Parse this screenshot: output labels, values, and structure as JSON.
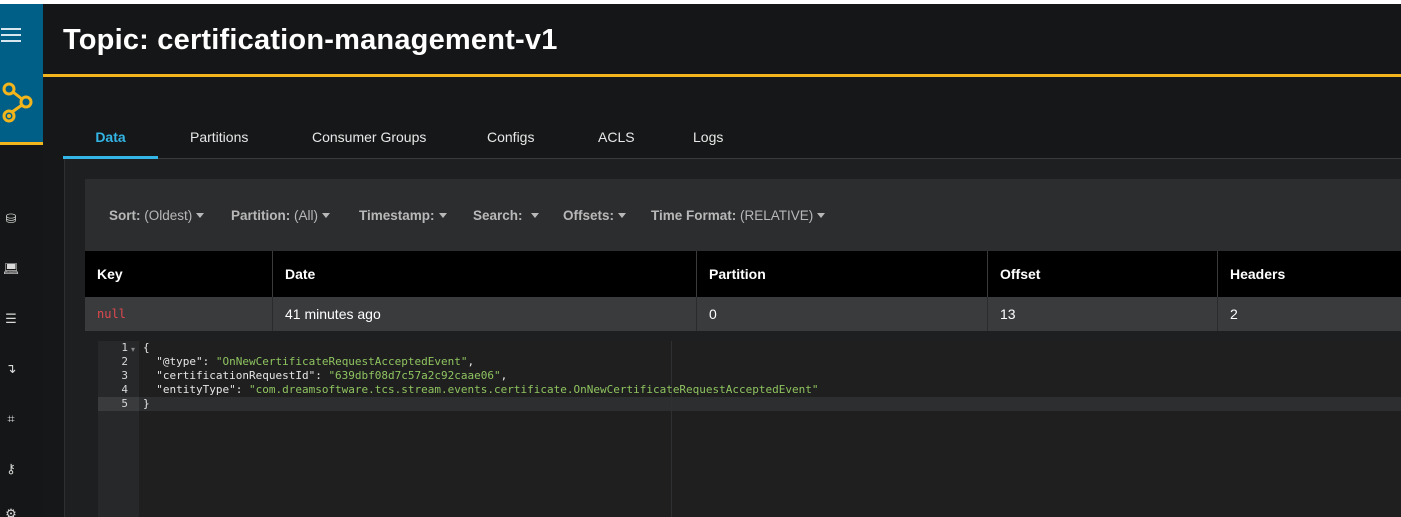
{
  "sidebar": {
    "menu_icon": "hamburger-menu-icon",
    "logo_icon": "kafka-logo",
    "nav_icons": [
      "database-icon",
      "laptop-icon",
      "list-icon",
      "download-arrow-icon",
      "frame-icon",
      "key-icon",
      "gear-icon"
    ],
    "brand_color": "#005f87",
    "accent_color": "#f2b51c"
  },
  "header": {
    "title": "Topic: certification-management-v1"
  },
  "tabs": [
    {
      "label": "Data",
      "active": true
    },
    {
      "label": "Partitions",
      "active": false
    },
    {
      "label": "Consumer Groups",
      "active": false
    },
    {
      "label": "Configs",
      "active": false
    },
    {
      "label": "ACLS",
      "active": false
    },
    {
      "label": "Logs",
      "active": false
    }
  ],
  "toolbar": {
    "sort": {
      "label": "Sort:",
      "value": "(Oldest)"
    },
    "partition": {
      "label": "Partition:",
      "value": "(All)"
    },
    "timestamp": {
      "label": "Timestamp:"
    },
    "search": {
      "label": "Search:"
    },
    "offsets": {
      "label": "Offsets:"
    },
    "time_format": {
      "label": "Time Format:",
      "value": "(RELATIVE)"
    }
  },
  "table": {
    "columns": [
      "Key",
      "Date",
      "Partition",
      "Offset",
      "Headers"
    ],
    "rows": [
      {
        "key": "null",
        "date": "41 minutes ago",
        "partition": "0",
        "offset": "13",
        "headers": "2"
      }
    ]
  },
  "editor": {
    "line_numbers": [
      "1",
      "2",
      "3",
      "4",
      "5"
    ],
    "lines": [
      {
        "key": "",
        "sep": "",
        "value": "{"
      },
      {
        "key": "  \"@type\"",
        "sep": ": ",
        "value": "\"OnNewCertificateRequestAcceptedEvent\"",
        "trail": ","
      },
      {
        "key": "  \"certificationRequestId\"",
        "sep": ": ",
        "value": "\"639dbf08d7c57a2c92caae06\"",
        "trail": ","
      },
      {
        "key": "  \"entityType\"",
        "sep": ": ",
        "value": "\"com.dreamsoftware.tcs.stream.events.certificate.OnNewCertificateRequestAcceptedEvent\"",
        "trail": ""
      },
      {
        "key": "",
        "sep": "",
        "value": "}"
      }
    ]
  },
  "colors": {
    "tab_active": "#33b5e5",
    "null_value": "#e0494f",
    "json_string": "#8fc45f"
  }
}
